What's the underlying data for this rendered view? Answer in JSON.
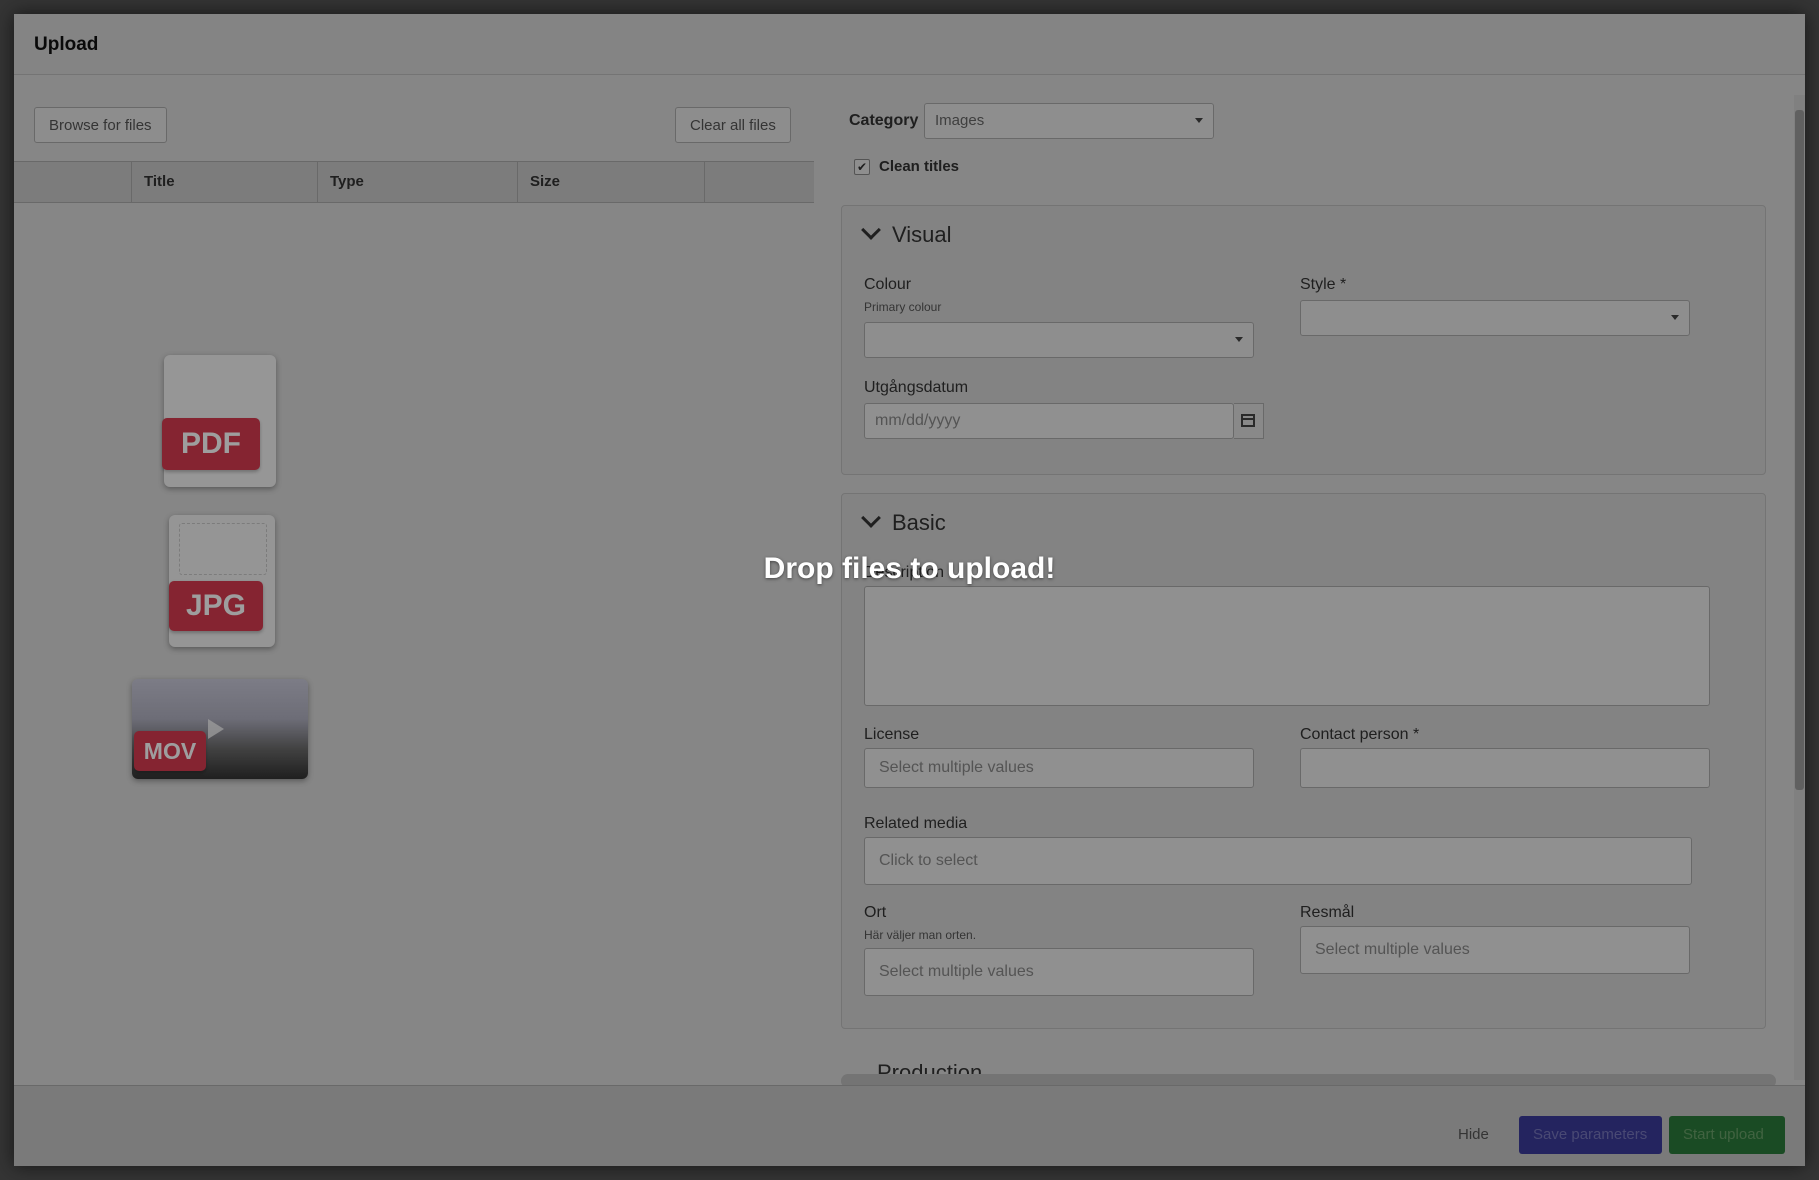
{
  "dialog": {
    "title": "Upload"
  },
  "left": {
    "browse_label": "Browse for files",
    "clear_label": "Clear all files",
    "columns": [
      "",
      "Title",
      "Type",
      "Size",
      ""
    ],
    "file_icons": [
      {
        "label": "PDF",
        "icon": "pdf-file-icon"
      },
      {
        "label": "JPG",
        "icon": "jpg-file-icon"
      },
      {
        "label": "MOV",
        "icon": "mov-file-icon"
      }
    ]
  },
  "right": {
    "category_label": "Category",
    "category_value": "Images",
    "clean_titles_label": "Clean titles",
    "clean_titles_checked": true,
    "visual": {
      "title": "Visual",
      "colour_label": "Colour",
      "colour_hint": "Primary colour",
      "colour_value": "",
      "style_label": "Style *",
      "style_value": "",
      "date_label": "Utgångsdatum",
      "date_placeholder": "mm/dd/yyyy"
    },
    "basic": {
      "title": "Basic",
      "description_label": "Description",
      "license_label": "License",
      "license_placeholder": "Select multiple values",
      "contact_label": "Contact person *",
      "related_label": "Related media",
      "related_placeholder": "Click to select",
      "ort_label": "Ort",
      "ort_hint": "Här väljer man orten.",
      "ort_placeholder": "Select multiple values",
      "resmal_label": "Resmål",
      "resmal_placeholder": "Select multiple values"
    },
    "production": {
      "title": "Production"
    }
  },
  "footer": {
    "hide_label": "Hide",
    "save_label": "Save parameters",
    "start_label": "Start upload"
  },
  "overlay": {
    "text": "Drop files to upload!"
  },
  "colors": {
    "accent_tag": "#d73b4f",
    "save_button": "#3a3a9a",
    "start_button": "#2b7a3a"
  }
}
